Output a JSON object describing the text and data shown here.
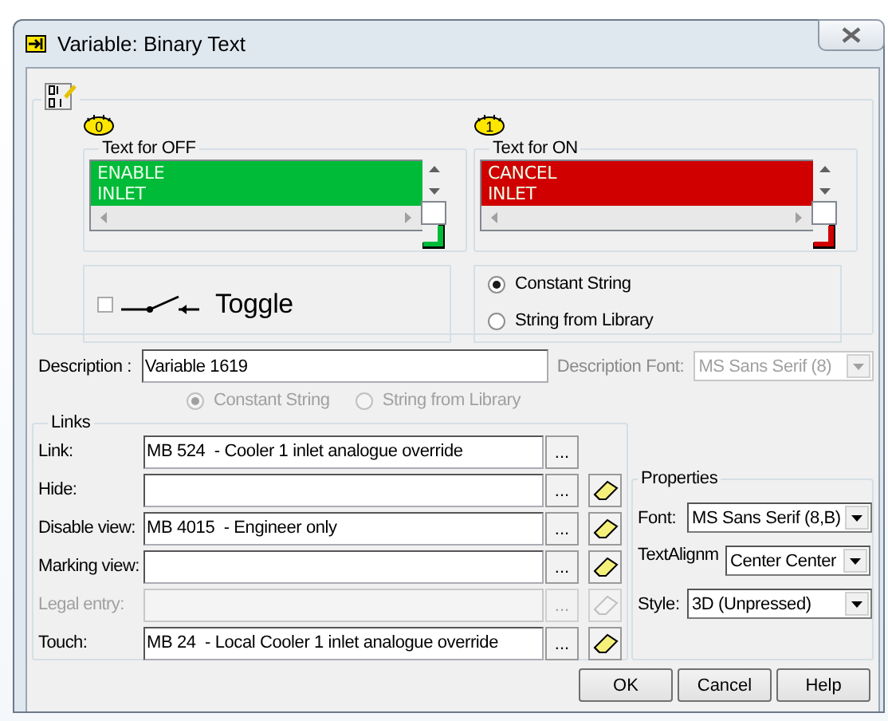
{
  "window": {
    "title": "Variable: Binary Text"
  },
  "states": [
    {
      "badge": "0",
      "label": "Text for OFF",
      "lines": [
        "ENABLE",
        "INLET"
      ],
      "color": "#00bb38"
    },
    {
      "badge": "1",
      "label": "Text for ON",
      "lines": [
        "CANCEL",
        "INLET"
      ],
      "color": "#d00000"
    }
  ],
  "toggle": {
    "checked": false,
    "label": "Toggle"
  },
  "source_options": [
    {
      "label": "Constant String",
      "selected": true
    },
    {
      "label": "String from Library",
      "selected": false
    }
  ],
  "description": {
    "label": "Description :",
    "value": "Variable 1619",
    "font_label": "Description Font:",
    "font_value": "MS Sans Serif (8)",
    "font_disabled": true
  },
  "description_source": {
    "disabled": true,
    "options": [
      {
        "label": "Constant String",
        "selected": true
      },
      {
        "label": "String from Library",
        "selected": false
      }
    ]
  },
  "links": {
    "title": "Links",
    "rows": [
      {
        "label": "Link:",
        "value": "MB 524  - Cooler 1 inlet analogue override",
        "browse": "...",
        "disabled": false,
        "clearable": false
      },
      {
        "label": "Hide:",
        "value": "",
        "browse": "...",
        "disabled": false,
        "clearable": true
      },
      {
        "label": "Disable view:",
        "value": "MB 4015  - Engineer only",
        "browse": "...",
        "disabled": false,
        "clearable": true
      },
      {
        "label": "Marking view:",
        "value": "",
        "browse": "...",
        "disabled": false,
        "clearable": true
      },
      {
        "label": "Legal entry:",
        "value": "",
        "browse": "...",
        "disabled": true,
        "clearable": true
      },
      {
        "label": "Touch:",
        "value": "MB 24  - Local Cooler 1 inlet analogue override",
        "browse": "...",
        "disabled": false,
        "clearable": true
      }
    ]
  },
  "properties": {
    "title": "Properties",
    "fields": [
      {
        "label": "Font:",
        "value": "MS Sans Serif (8,B)"
      },
      {
        "label": "TextAlignm",
        "value": "Center Center"
      },
      {
        "label": "Style:",
        "value": "3D (Unpressed)"
      }
    ]
  },
  "buttons": [
    "OK",
    "Cancel",
    "Help"
  ]
}
